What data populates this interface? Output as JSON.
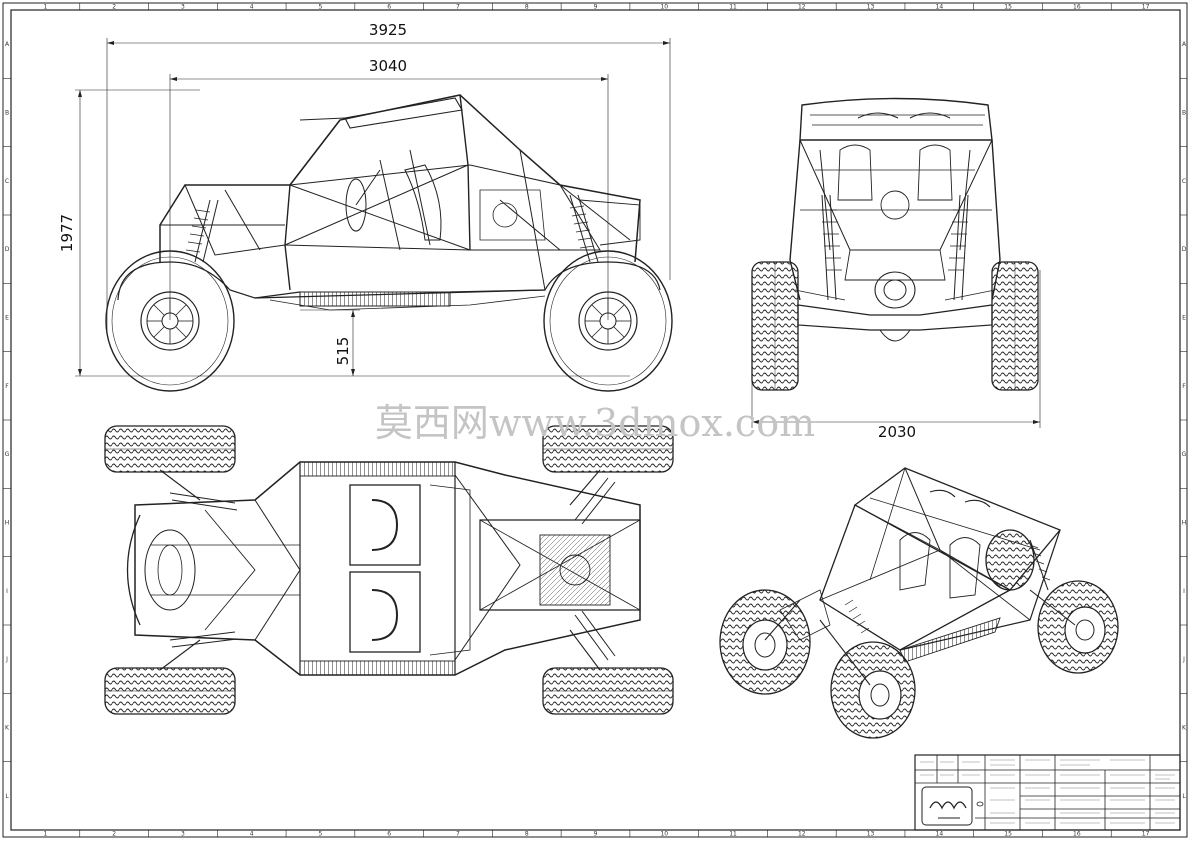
{
  "grid": {
    "columns": [
      "1",
      "2",
      "3",
      "4",
      "5",
      "6",
      "7",
      "8",
      "9",
      "10",
      "11",
      "12",
      "13",
      "14",
      "15",
      "16",
      "17"
    ],
    "rows": [
      "A",
      "B",
      "C",
      "D",
      "E",
      "F",
      "G",
      "H",
      "I",
      "J",
      "K",
      "L"
    ]
  },
  "dimensions": {
    "overall_length": "3925",
    "wheelbase": "3040",
    "height": "1977",
    "ground_clearance": "515",
    "width": "2030"
  },
  "watermark": "莫西网www.3dmox.com"
}
